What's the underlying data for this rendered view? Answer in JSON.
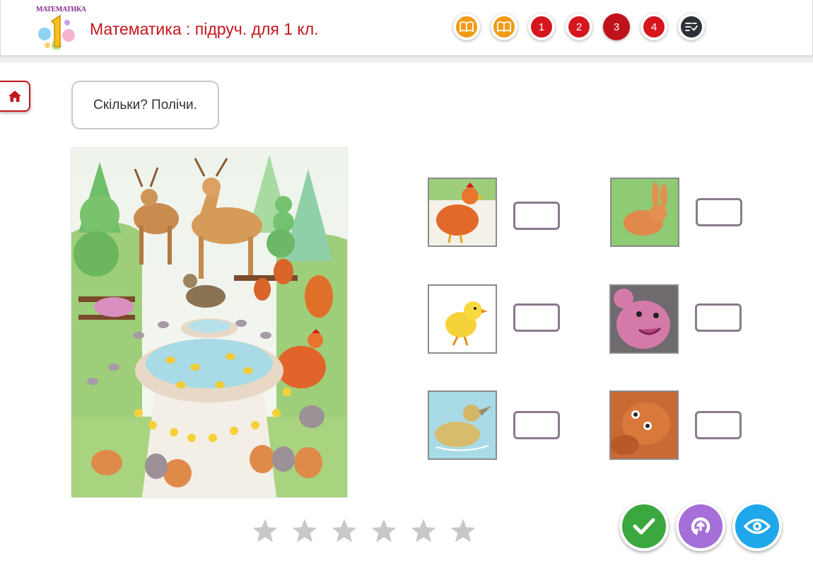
{
  "header": {
    "logo_text": "МАТЕМАТИКА",
    "logo_digit": "1",
    "title": "Математика : підруч. для 1 кл."
  },
  "nav": {
    "items": [
      {
        "kind": "book",
        "icon": "book-icon",
        "color": "#f29b12"
      },
      {
        "kind": "book",
        "icon": "book-icon",
        "color": "#f29b12"
      },
      {
        "kind": "number",
        "label": "1",
        "color": "#d6161d"
      },
      {
        "kind": "number",
        "label": "2",
        "color": "#d6161d"
      },
      {
        "kind": "number",
        "label": "3",
        "color": "#c0121a",
        "active": true
      },
      {
        "kind": "number",
        "label": "4",
        "color": "#d6161d"
      },
      {
        "kind": "checklist",
        "icon": "checklist-icon",
        "color": "#2c3138"
      }
    ]
  },
  "home": {
    "icon": "home-icon",
    "color": "#c4161c"
  },
  "task": {
    "text": "Скільки? Полічи."
  },
  "scene": {
    "description_icon": "park-illustration"
  },
  "counting": {
    "items": [
      {
        "animal": "hen",
        "value": ""
      },
      {
        "animal": "rabbit",
        "value": ""
      },
      {
        "animal": "chick",
        "value": ""
      },
      {
        "animal": "mouse",
        "value": ""
      },
      {
        "animal": "duckling",
        "value": ""
      },
      {
        "animal": "squirrel",
        "value": ""
      }
    ]
  },
  "rating": {
    "stars_total": 6,
    "stars_filled": 0,
    "star_color": "#c8c8c8"
  },
  "actions": [
    {
      "name": "check-button",
      "icon": "checkmark-icon",
      "color": "#3aa83e"
    },
    {
      "name": "reset-button",
      "icon": "reset-icon",
      "color": "#a56ed8"
    },
    {
      "name": "show-answer-button",
      "icon": "eye-icon",
      "color": "#1ea7ea"
    }
  ]
}
